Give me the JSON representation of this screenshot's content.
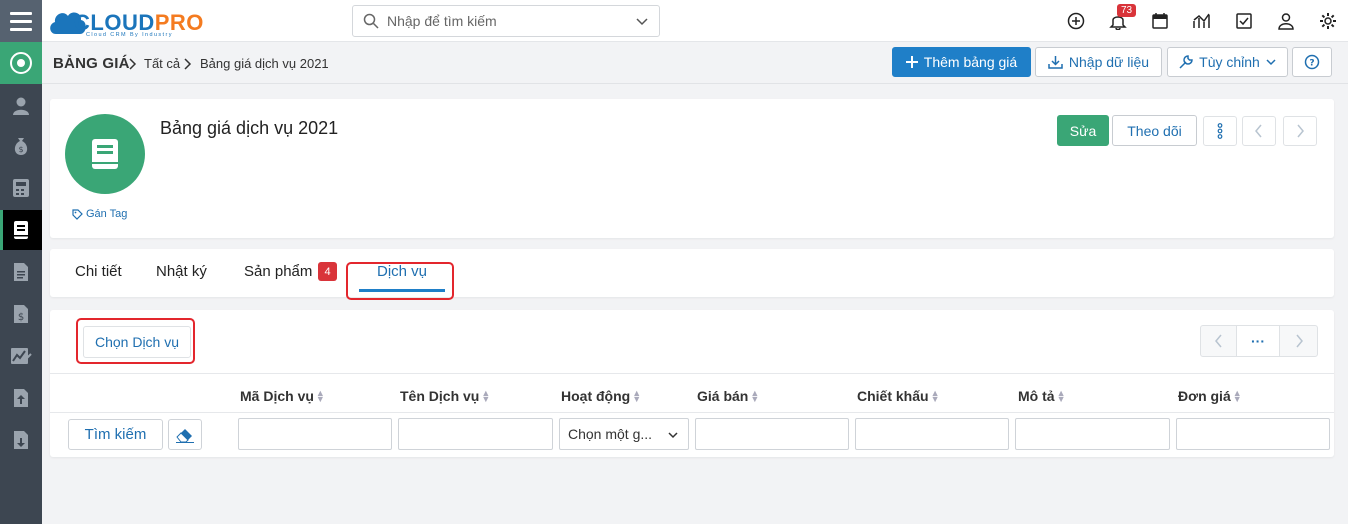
{
  "header": {
    "logo_text_cloud": "CLOUD",
    "logo_text_pro": "PRO",
    "logo_subtitle": "Cloud CRM By Industry",
    "search_placeholder": "Nhập để tìm kiếm",
    "notification_count": "73"
  },
  "breadcrumb": {
    "module": "BẢNG GIÁ",
    "level1": "Tất cả",
    "level2": "Bảng giá dịch vụ 2021"
  },
  "toolbar": {
    "add_label": "Thêm bảng giá",
    "import_label": "Nhập dữ liệu",
    "customize_label": "Tùy chỉnh"
  },
  "record": {
    "title": "Bảng giá dịch vụ 2021",
    "tag_label": "Gán Tag",
    "edit_label": "Sửa",
    "follow_label": "Theo dõi"
  },
  "tabs": [
    {
      "label": "Chi tiết"
    },
    {
      "label": "Nhật ký"
    },
    {
      "label": "Sản phẩm",
      "badge": "4"
    },
    {
      "label": "Dịch vụ",
      "active": true
    }
  ],
  "related": {
    "select_button": "Chọn Dịch vụ",
    "pager_more": "···",
    "columns": [
      "Mã Dịch vụ",
      "Tên Dịch vụ",
      "Hoạt động",
      "Giá bán",
      "Chiết khấu",
      "Mô tả",
      "Đơn giá"
    ],
    "search_button": "Tìm kiếm",
    "status_select": "Chọn một g..."
  },
  "colors": {
    "primary": "#1f7fc8",
    "green": "#3aa676",
    "sidebar": "#3d4651",
    "badge_red": "#d9343a",
    "highlight_red": "#e3262d"
  }
}
